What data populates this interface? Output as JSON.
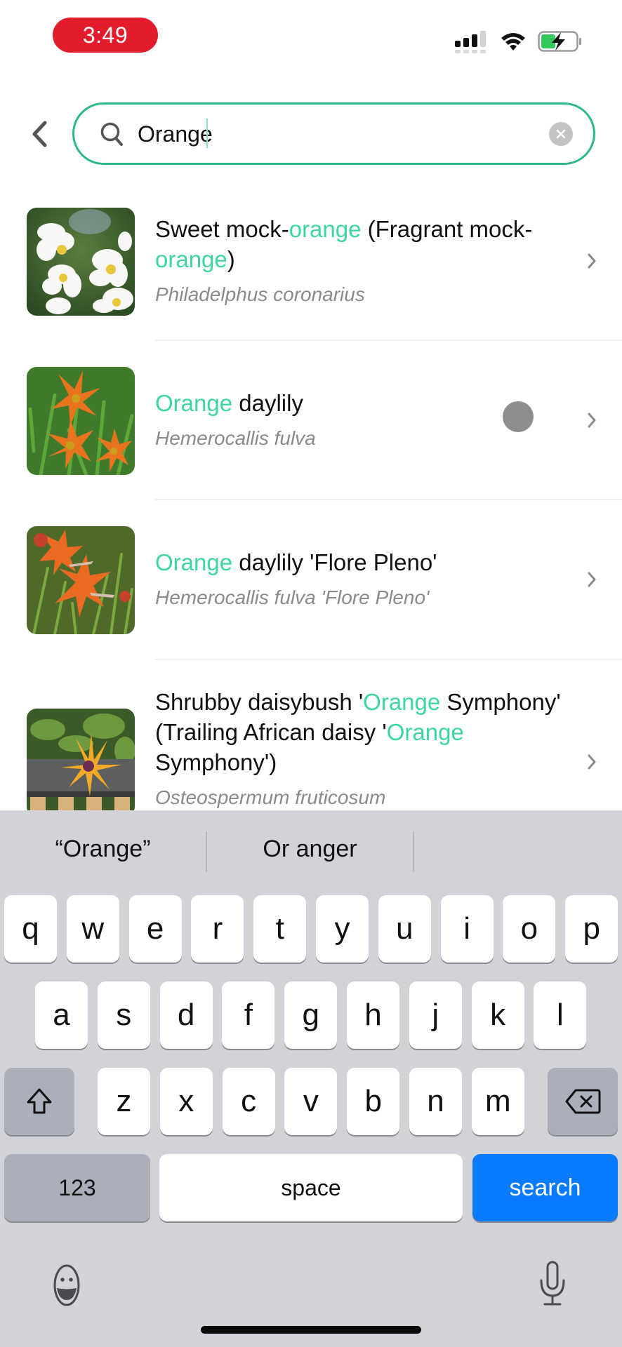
{
  "status_bar": {
    "time": "3:49",
    "time_pill_color": "#e31c2c",
    "signal_bars_active": 3,
    "signal_bars_total": 4,
    "wifi": "wifi-icon",
    "battery_level": 0.4,
    "battery_charging": true,
    "battery_color": "#34c759"
  },
  "header": {
    "back_icon": "chevron-left-icon",
    "search": {
      "value": "Orange",
      "placeholder": "",
      "icon": "search-icon",
      "clear_icon": "clear-circle-icon",
      "border_color": "#2db88a"
    }
  },
  "accent_highlight_color": "#3ed6a0",
  "results": [
    {
      "title_parts": [
        {
          "text": "Sweet mock-",
          "hl": false
        },
        {
          "text": "orange",
          "hl": true
        },
        {
          "text": " (Fragrant mock-",
          "hl": false
        },
        {
          "text": "orange",
          "hl": true
        },
        {
          "text": ")",
          "hl": false
        }
      ],
      "scientific_name": "Philadelphus coronarius",
      "image": "white mock-orange flowers"
    },
    {
      "title_parts": [
        {
          "text": "Orange",
          "hl": true
        },
        {
          "text": " daylily",
          "hl": false
        }
      ],
      "scientific_name": "Hemerocallis fulva",
      "image": "orange daylily flowers"
    },
    {
      "title_parts": [
        {
          "text": "Orange",
          "hl": true
        },
        {
          "text": " daylily 'Flore Pleno'",
          "hl": false
        }
      ],
      "scientific_name": "Hemerocallis fulva 'Flore Pleno'",
      "image": "double orange daylily flowers"
    },
    {
      "title_parts": [
        {
          "text": "Shrubby daisybush '",
          "hl": false
        },
        {
          "text": "Orange",
          "hl": true
        },
        {
          "text": " Symphony' (Trailing African daisy '",
          "hl": false
        },
        {
          "text": "Orange",
          "hl": true
        },
        {
          "text": " Symphony')",
          "hl": false
        }
      ],
      "scientific_name": "Osteospermum fruticosum",
      "image": "orange-yellow daisy in planter"
    }
  ],
  "keyboard": {
    "suggestions": [
      "“Orange”",
      "Or anger",
      ""
    ],
    "rows": [
      [
        "q",
        "w",
        "e",
        "r",
        "t",
        "y",
        "u",
        "i",
        "o",
        "p"
      ],
      [
        "a",
        "s",
        "d",
        "f",
        "g",
        "h",
        "j",
        "k",
        "l"
      ],
      [
        "z",
        "x",
        "c",
        "v",
        "b",
        "n",
        "m"
      ]
    ],
    "shift_icon": "shift-icon",
    "backspace_icon": "backspace-icon",
    "numbers_label": "123",
    "space_label": "space",
    "return_label": "search",
    "return_color": "#0a7aff",
    "emoji_icon": "emoji-icon",
    "mic_icon": "microphone-icon"
  }
}
